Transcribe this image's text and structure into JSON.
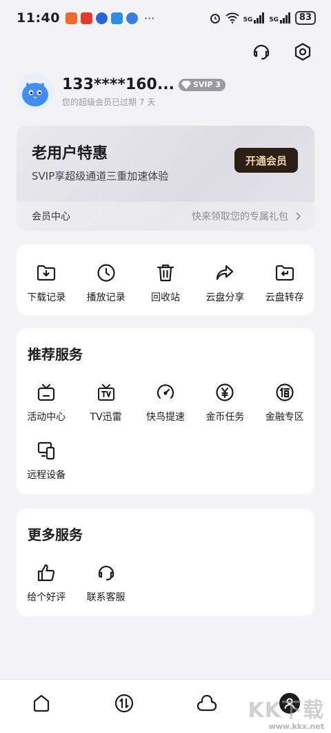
{
  "status_bar": {
    "time": "11:40",
    "dots": "···",
    "network_label_1": "5G",
    "network_label_2": "5G",
    "battery": "83",
    "app_icon_colors": [
      "#f06a2a",
      "#e23a2e",
      "#2a63d8",
      "#2a8de8",
      "#3b7de0"
    ]
  },
  "header": {
    "icons": [
      "headset-icon",
      "settings-icon"
    ]
  },
  "profile": {
    "username": "133****160...",
    "badge": "SVIP 3",
    "subtitle": "您的超级会员已过期 7 天"
  },
  "vip_card": {
    "title": "老用户特惠",
    "description": "SVIP享超级通道三重加速体验",
    "button": "开通会员",
    "footer_left": "会员中心",
    "footer_right": "快来领取您的专属礼包"
  },
  "quick_tools": [
    {
      "icon": "download-folder-icon",
      "label": "下载记录"
    },
    {
      "icon": "play-history-icon",
      "label": "播放记录"
    },
    {
      "icon": "trash-icon",
      "label": "回收站"
    },
    {
      "icon": "share-icon",
      "label": "云盘分享"
    },
    {
      "icon": "transfer-folder-icon",
      "label": "云盘转存"
    }
  ],
  "recommended": {
    "title": "推荐服务",
    "items": [
      {
        "icon": "activity-tv-icon",
        "label": "活动中心"
      },
      {
        "icon": "tv-icon",
        "label": "TV迅雷"
      },
      {
        "icon": "speedometer-icon",
        "label": "快鸟提速"
      },
      {
        "icon": "coin-icon",
        "label": "金币任务"
      },
      {
        "icon": "loan-icon",
        "label": "金融专区"
      },
      {
        "icon": "remote-device-icon",
        "label": "远程设备"
      }
    ]
  },
  "more": {
    "title": "更多服务",
    "items": [
      {
        "icon": "thumbs-up-icon",
        "label": "给个好评"
      },
      {
        "icon": "headset-icon",
        "label": "联系客服"
      }
    ]
  },
  "tabbar": {
    "tabs": [
      "home-tab",
      "transfer-tab",
      "cloud-tab",
      "profile-tab"
    ]
  },
  "watermark": {
    "text": "KK下载",
    "url": "www.kkx.net"
  }
}
